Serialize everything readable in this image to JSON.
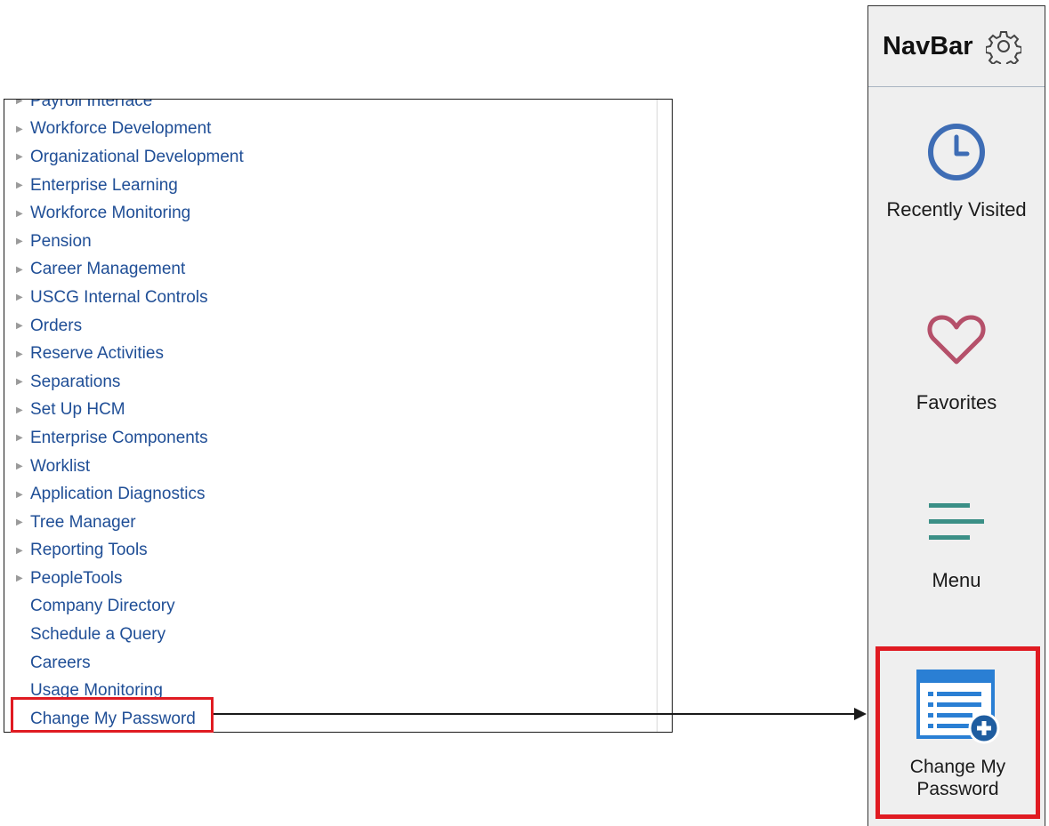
{
  "menu": {
    "items": [
      {
        "label": "Payroll Interface",
        "folder": true
      },
      {
        "label": "Workforce Development",
        "folder": true
      },
      {
        "label": "Organizational Development",
        "folder": true
      },
      {
        "label": "Enterprise Learning",
        "folder": true
      },
      {
        "label": "Workforce Monitoring",
        "folder": true
      },
      {
        "label": "Pension",
        "folder": true
      },
      {
        "label": "Career Management",
        "folder": true
      },
      {
        "label": "USCG Internal Controls",
        "folder": true
      },
      {
        "label": "Orders",
        "folder": true
      },
      {
        "label": "Reserve Activities",
        "folder": true
      },
      {
        "label": "Separations",
        "folder": true
      },
      {
        "label": "Set Up HCM",
        "folder": true
      },
      {
        "label": "Enterprise Components",
        "folder": true
      },
      {
        "label": "Worklist",
        "folder": true
      },
      {
        "label": "Application Diagnostics",
        "folder": true
      },
      {
        "label": "Tree Manager",
        "folder": true
      },
      {
        "label": "Reporting Tools",
        "folder": true
      },
      {
        "label": "PeopleTools",
        "folder": true
      },
      {
        "label": "Company Directory",
        "folder": false
      },
      {
        "label": "Schedule a Query",
        "folder": false
      },
      {
        "label": "Careers",
        "folder": false
      },
      {
        "label": "Usage Monitoring",
        "folder": false
      },
      {
        "label": "Change My Password",
        "folder": false
      }
    ]
  },
  "navbar": {
    "title": "NavBar",
    "title_icon": "gear-icon",
    "tiles": {
      "recent": {
        "label": "Recently Visited",
        "icon": "clock-icon",
        "color": "#3e6db5"
      },
      "favorites": {
        "label": "Favorites",
        "icon": "heart-icon",
        "color": "#b5506a"
      },
      "menu": {
        "label": "Menu",
        "icon": "menu-lines-icon",
        "color": "#3b8f86"
      },
      "password": {
        "label_line1": "Change My",
        "label_line2": "Password",
        "icon": "list-add-icon",
        "color": "#2a7fd4"
      }
    }
  },
  "colors": {
    "link": "#1f4e96",
    "highlight": "#e01b22"
  }
}
